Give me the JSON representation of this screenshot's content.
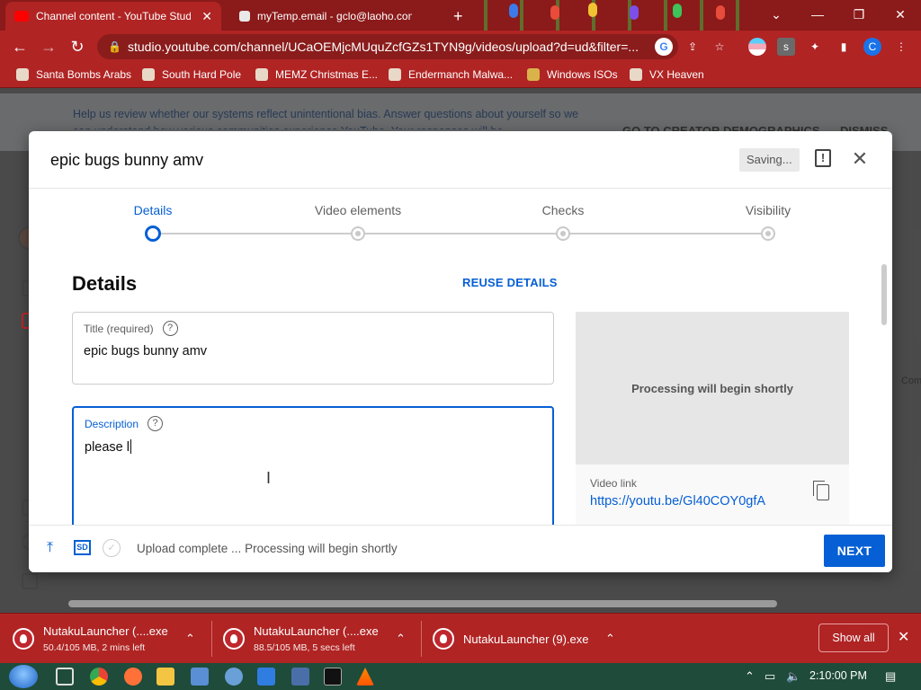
{
  "browser": {
    "tabs": [
      {
        "title": "Channel content - YouTube Studi",
        "close": "✕"
      },
      {
        "title": "myTemp.email - gclo@laoho.com",
        "close": ""
      }
    ],
    "new_tab": "+",
    "url": "studio.youtube.com/channel/UCaOEMjcMUquZcfGZs1TYN9g/videos/upload?d=ud&filter=...",
    "bookmarks": [
      "Santa Bombs Arabs",
      "South Hard Pole",
      "MEMZ Christmas E...",
      "Endermanch Malwa...",
      "Windows ISOs",
      "VX Heaven"
    ],
    "profile_initial": "C",
    "ext_initial": "s"
  },
  "page": {
    "banner_text": "Help us review whether our systems reflect unintentional bias. Answer questions about yourself so we can understand how various communities experience YouTube. Your responses will be",
    "banner_action": "GO TO CREATOR DEMOGRAPHICS",
    "banner_dismiss": "DISMISS",
    "side_text": "Com"
  },
  "dialog": {
    "title": "epic bugs bunny amv",
    "saving": "Saving...",
    "steps": [
      {
        "label": "Details",
        "active": true
      },
      {
        "label": "Video elements",
        "active": false
      },
      {
        "label": "Checks",
        "active": false
      },
      {
        "label": "Visibility",
        "active": false
      }
    ],
    "heading": "Details",
    "reuse": "REUSE DETAILS",
    "title_field": {
      "label": "Title (required)",
      "value": "epic bugs bunny amv"
    },
    "description_field": {
      "label": "Description",
      "value": "please l"
    },
    "help_glyph": "?",
    "preview_text": "Processing will begin shortly",
    "video_link_label": "Video link",
    "video_link": "https://youtu.be/Gl40COY0gfA",
    "footer_status": "Upload complete ... Processing will begin shortly",
    "sd_badge": "SD",
    "next": "NEXT"
  },
  "downloads": [
    {
      "name": "NutakuLauncher (....exe",
      "status": "50.4/105 MB, 2 mins left"
    },
    {
      "name": "NutakuLauncher (....exe",
      "status": "88.5/105 MB, 5 secs left"
    },
    {
      "name": "NutakuLauncher (9).exe",
      "status": ""
    }
  ],
  "downloads_show_all": "Show all",
  "taskbar": {
    "time": "2:10:00 PM"
  },
  "colors": {
    "chrome_red": "#b02424",
    "accent_blue": "#065fd4",
    "taskbar": "#1f4b3a"
  }
}
